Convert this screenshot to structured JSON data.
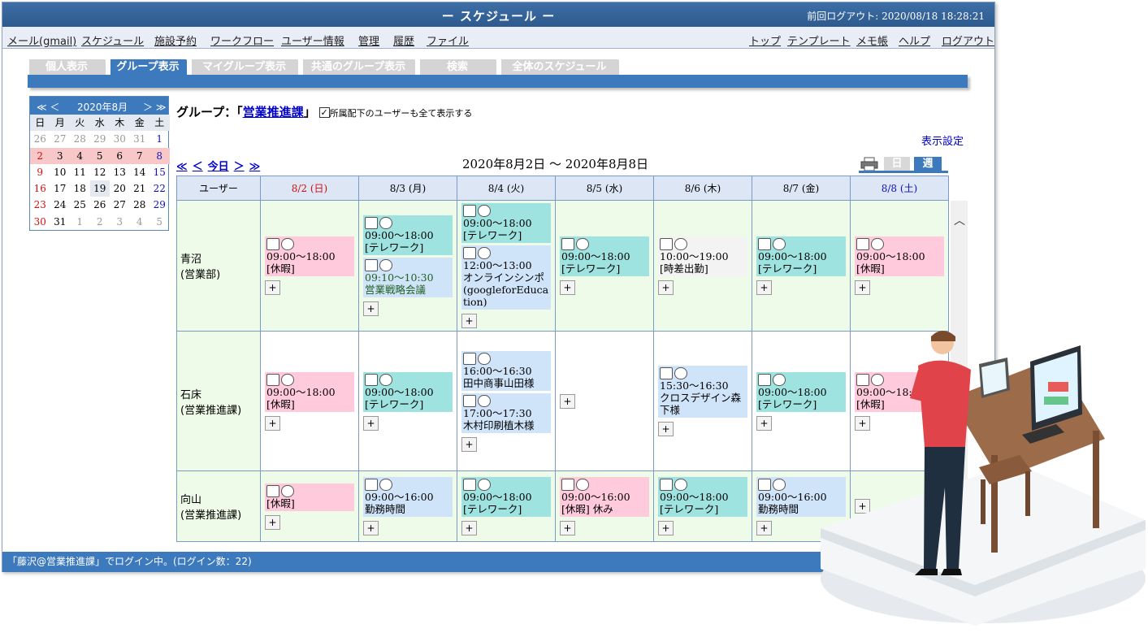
{
  "titlebar": {
    "title": "ー スケジュール ー",
    "last_logout": "前回ログアウト: 2020/08/18 18:28:21"
  },
  "menu": {
    "left": [
      "メール(gmail)",
      "スケジュール",
      "施設予約",
      "ワークフロー",
      "ユーザー情報",
      "管理",
      "履歴",
      "ファイル"
    ],
    "right": [
      "トップ",
      "テンプレート",
      "メモ帳",
      "ヘルプ",
      "ログアウト"
    ]
  },
  "tabs": [
    "個人表示",
    "グループ表示",
    "マイグループ表示",
    "共通のグループ表示",
    "検索",
    "全体のスケジュール"
  ],
  "mini_calendar": {
    "prev": "≪ ＜",
    "next": "＞ ≫",
    "month": "2020年8月",
    "weekdays": [
      "日",
      "月",
      "火",
      "水",
      "木",
      "金",
      "土"
    ],
    "weeks": [
      [
        "26",
        "27",
        "28",
        "29",
        "30",
        "31",
        "1"
      ],
      [
        "2",
        "3",
        "4",
        "5",
        "6",
        "7",
        "8"
      ],
      [
        "9",
        "10",
        "11",
        "12",
        "13",
        "14",
        "15"
      ],
      [
        "16",
        "17",
        "18",
        "19",
        "20",
        "21",
        "22"
      ],
      [
        "23",
        "24",
        "25",
        "26",
        "27",
        "28",
        "29"
      ],
      [
        "30",
        "31",
        "1",
        "2",
        "3",
        "4",
        "5"
      ]
    ]
  },
  "group": {
    "prefix": "グループ：「",
    "name": "営業推進課",
    "suffix": "」",
    "checkbox_mark": "✓",
    "checkbox_label": "所属配下のユーザーも全て表示する"
  },
  "display_settings": "表示設定",
  "nav": {
    "prev_week": "≪",
    "prev_day": "＜",
    "today": "今日",
    "next_day": "＞",
    "next_week": "≫"
  },
  "date_range": "2020年8月2日 〜 2020年8月8日",
  "view": {
    "day": "日",
    "week": "週"
  },
  "table": {
    "user_header": "ユーザー",
    "days": [
      "8/2 (日)",
      "8/3 (月)",
      "8/4 (火)",
      "8/5 (水)",
      "8/6 (木)",
      "8/7 (金)",
      "8/8 (土)"
    ],
    "rows": [
      {
        "name": "青沼",
        "dept": "(営業部)",
        "cells": [
          [
            {
              "c": "p",
              "time": "09:00〜18:00",
              "title": "[休暇]"
            }
          ],
          [
            {
              "c": "t",
              "time": "09:00〜18:00",
              "title": "[テレワーク]"
            },
            {
              "c": "b",
              "time": "09:10〜10:30",
              "title": "営業戦略会議",
              "green": true
            }
          ],
          [
            {
              "c": "t",
              "time": "09:00〜18:00",
              "title": "[テレワーク]"
            },
            {
              "c": "b",
              "time": "12:00〜13:00",
              "title": "オンラインシンポ(googleforEducation)"
            }
          ],
          [
            {
              "c": "t",
              "time": "09:00〜18:00",
              "title": "[テレワーク]"
            }
          ],
          [
            {
              "c": "w",
              "time": "10:00〜19:00",
              "title": "[時差出勤]"
            }
          ],
          [
            {
              "c": "t",
              "time": "09:00〜18:00",
              "title": "[テレワーク]"
            }
          ],
          [
            {
              "c": "p",
              "time": "09:00〜18:00",
              "title": "[休暇]"
            }
          ]
        ]
      },
      {
        "name": "石床",
        "dept": "(営業推進課)",
        "cells": [
          [
            {
              "c": "p",
              "time": "09:00〜18:00",
              "title": "[休暇]"
            }
          ],
          [
            {
              "c": "t",
              "time": "09:00〜18:00",
              "title": "[テレワーク]"
            }
          ],
          [
            {
              "c": "b",
              "time": "16:00〜16:30",
              "title": "田中商事山田様"
            },
            {
              "c": "b",
              "time": "17:00〜17:30",
              "title": "木村印刷植木様"
            }
          ],
          [],
          [
            {
              "c": "b",
              "time": "15:30〜16:30",
              "title": "クロスデザイン森下様"
            }
          ],
          [
            {
              "c": "t",
              "time": "09:00〜18:00",
              "title": "[テレワーク]"
            }
          ],
          [
            {
              "c": "p",
              "time": "09:00〜18:00",
              "title": "[休暇]"
            }
          ]
        ]
      },
      {
        "name": "向山",
        "dept": "(営業推進課)",
        "cells": [
          [
            {
              "c": "p",
              "time": "",
              "title": "[休暇]"
            }
          ],
          [
            {
              "c": "b",
              "time": "09:00〜16:00",
              "title": "勤務時間"
            }
          ],
          [
            {
              "c": "t",
              "time": "09:00〜18:00",
              "title": "[テレワーク]"
            }
          ],
          [
            {
              "c": "p",
              "time": "09:00〜16:00",
              "title": "[休暇] 休み"
            }
          ],
          [
            {
              "c": "t",
              "time": "09:00〜18:00",
              "title": "[テレワーク]"
            }
          ],
          [
            {
              "c": "b",
              "time": "09:00〜16:00",
              "title": "勤務時間"
            }
          ],
          []
        ]
      }
    ],
    "add_label": "+"
  },
  "status": "「藤沢@営業推進課」でログイン中。(ログイン数：22)",
  "colors": {
    "accent": "#3d79bd",
    "holiday": "#ffcadb",
    "telework": "#9fe3e0",
    "meeting": "#cfe3f9",
    "cell_bg": "#eefbe8"
  }
}
